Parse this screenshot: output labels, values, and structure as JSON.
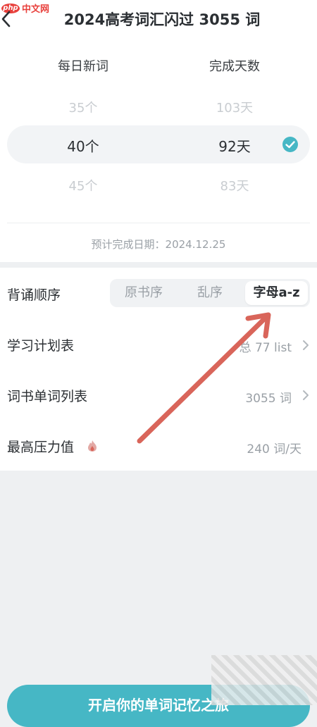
{
  "watermark": {
    "logo_text": "php",
    "site_text": "中文网"
  },
  "header": {
    "title": "2024高考词汇闪过 3055 词"
  },
  "plan_picker": {
    "columns": [
      "每日新词",
      "完成天数"
    ],
    "options": [
      {
        "daily": "35个",
        "days": "103天"
      },
      {
        "daily": "40个",
        "days": "92天"
      },
      {
        "daily": "45个",
        "days": "83天"
      }
    ],
    "estimate": "预计完成日期：2024.12.25"
  },
  "settings": {
    "order": {
      "label": "背诵顺序",
      "options": [
        "原书序",
        "乱序",
        "字母a-z"
      ],
      "selected": "字母a-z"
    },
    "schedule": {
      "label": "学习计划表",
      "value": "总 77 list"
    },
    "wordlist": {
      "label": "词书单词列表",
      "value": "3055 词"
    },
    "pressure": {
      "label": "最高压力值",
      "value": "240 词/天"
    }
  },
  "start_button": {
    "label": "开启你的单词记忆之旅"
  },
  "colors": {
    "accent": "#46b7c5",
    "annotation_arrow": "#d9655a",
    "watermark": "#e8403c"
  }
}
